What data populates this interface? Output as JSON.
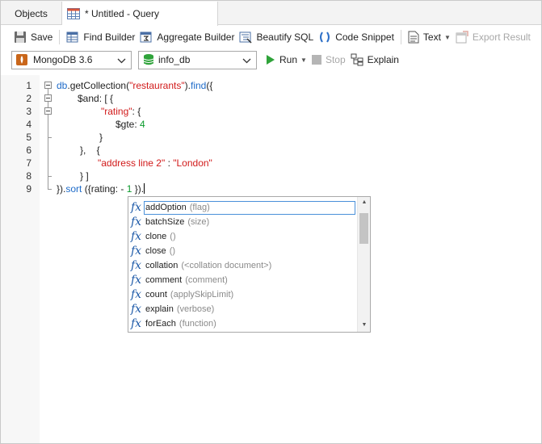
{
  "tabs": {
    "objects": "Objects",
    "query": "* Untitled - Query"
  },
  "toolbar": {
    "save": "Save",
    "find_builder": "Find Builder",
    "aggregate_builder": "Aggregate Builder",
    "beautify": "Beautify SQL",
    "code_snippet": "Code Snippet",
    "text": "Text",
    "export_result": "Export Result"
  },
  "connection": {
    "server": "MongoDB 3.6",
    "database": "info_db",
    "run": "Run",
    "stop": "Stop",
    "explain": "Explain"
  },
  "editor": {
    "line_numbers": [
      "1",
      "2",
      "3",
      "4",
      "5",
      "6",
      "7",
      "8",
      "9"
    ],
    "lines": {
      "l1_a": "db",
      "l1_b": ".getCollection(",
      "l1_c": "\"restaurants\"",
      "l1_d": ").",
      "l1_e": "find",
      "l1_f": "({",
      "l2": "$and: [ {",
      "l3_a": "\"rating\"",
      "l3_b": ": {",
      "l4_a": "$gte: ",
      "l4_b": "4",
      "l5": "}",
      "l6": "},    {",
      "l7_a": "\"address line 2\"",
      "l7_b": " : ",
      "l7_c": "\"London\"",
      "l8": "} ]",
      "l9_a": "}).",
      "l9_b": "sort",
      "l9_c": " ({rating: - ",
      "l9_d": "1",
      "l9_e": " })."
    }
  },
  "autocomplete": {
    "items": [
      {
        "name": "addOption",
        "args": "(flag)"
      },
      {
        "name": "batchSize",
        "args": "(size)"
      },
      {
        "name": "clone",
        "args": "()"
      },
      {
        "name": "close",
        "args": "()"
      },
      {
        "name": "collation",
        "args": "(<collation document>)"
      },
      {
        "name": "comment",
        "args": "(comment)"
      },
      {
        "name": "count",
        "args": "(applySkipLimit)"
      },
      {
        "name": "explain",
        "args": "(verbose)"
      },
      {
        "name": "forEach",
        "args": "(function)"
      }
    ],
    "icon": "fx"
  },
  "colors": {
    "keyword": "#1e6bc9",
    "string": "#d11a1a",
    "number": "#0b9a2c",
    "db_icon": "#2fa33a",
    "mongo_icon": "#c9661a"
  }
}
